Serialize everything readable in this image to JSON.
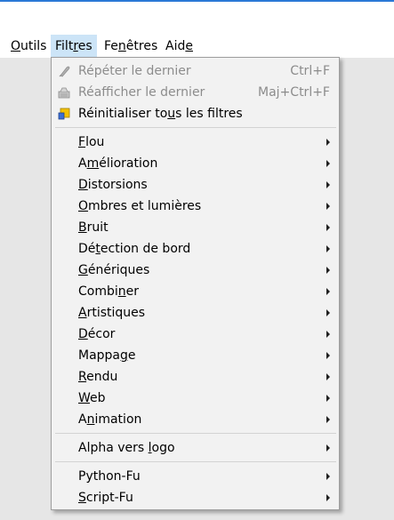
{
  "menubar": {
    "items": [
      {
        "before": "",
        "mn": "O",
        "after": "utils"
      },
      {
        "before": "Filt",
        "mn": "r",
        "after": "es"
      },
      {
        "before": "Fe",
        "mn": "n",
        "after": "êtres"
      },
      {
        "before": "Aid",
        "mn": "e",
        "after": ""
      }
    ],
    "active_index": 1
  },
  "filters_menu": {
    "top_items": [
      {
        "before": "Répéter le dernier",
        "mn": "",
        "after": "",
        "accel": "Ctrl+F",
        "icon": "repeat-filter-icon",
        "disabled": true
      },
      {
        "before": "Réafficher le dernier",
        "mn": "",
        "after": "",
        "accel": "Maj+Ctrl+F",
        "icon": "reshow-filter-icon",
        "disabled": true
      },
      {
        "before": "Réinitialiser to",
        "mn": "u",
        "after": "s les filtres",
        "accel": "",
        "icon": "reset-filters-icon",
        "disabled": false
      }
    ],
    "submenus": [
      {
        "before": "",
        "mn": "F",
        "after": "lou"
      },
      {
        "before": "A",
        "mn": "m",
        "after": "élioration"
      },
      {
        "before": "",
        "mn": "D",
        "after": "istorsions"
      },
      {
        "before": "",
        "mn": "O",
        "after": "mbres et lumières"
      },
      {
        "before": "",
        "mn": "B",
        "after": "ruit"
      },
      {
        "before": "Dé",
        "mn": "t",
        "after": "ection de bord"
      },
      {
        "before": "",
        "mn": "G",
        "after": "énériques"
      },
      {
        "before": "Combi",
        "mn": "n",
        "after": "er"
      },
      {
        "before": "",
        "mn": "A",
        "after": "rtistiques"
      },
      {
        "before": "",
        "mn": "D",
        "after": "écor"
      },
      {
        "before": "Mappa",
        "mn": "g",
        "after": "e"
      },
      {
        "before": "",
        "mn": "R",
        "after": "endu"
      },
      {
        "before": "",
        "mn": "W",
        "after": "eb"
      },
      {
        "before": "A",
        "mn": "n",
        "after": "imation"
      }
    ],
    "alpha_item": {
      "before": "Alpha vers ",
      "mn": "l",
      "after": "ogo"
    },
    "script_items": [
      {
        "before": "Python-Fu",
        "mn": "",
        "after": ""
      },
      {
        "before": "",
        "mn": "S",
        "after": "cript-Fu"
      }
    ]
  },
  "colors": {
    "menubar_active_bg": "#cce4f7",
    "menu_bg": "#f2f2f2",
    "disabled_text": "#8c8c8c",
    "reset_icon_yellow": "#f2c100",
    "reset_icon_blue": "#3b6ed4"
  }
}
